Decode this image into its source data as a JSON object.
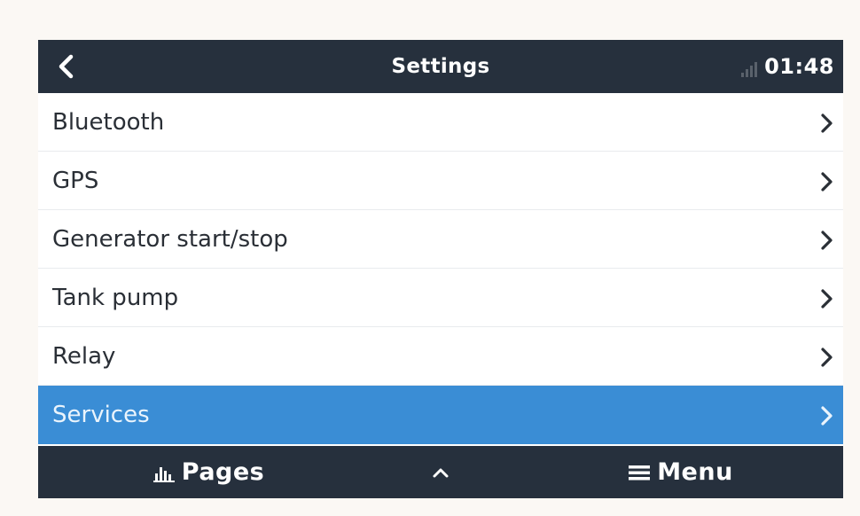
{
  "header": {
    "back_icon": "chevron-left-icon",
    "title": "Settings",
    "signal_icon": "signal-strength-icon",
    "time": "01:48"
  },
  "menu": {
    "items": [
      {
        "label": "Bluetooth",
        "selected": false,
        "icon": "chevron-right-icon"
      },
      {
        "label": "GPS",
        "selected": false,
        "icon": "chevron-right-icon"
      },
      {
        "label": "Generator start/stop",
        "selected": false,
        "icon": "chevron-right-icon"
      },
      {
        "label": "Tank pump",
        "selected": false,
        "icon": "chevron-right-icon"
      },
      {
        "label": "Relay",
        "selected": false,
        "icon": "chevron-right-icon"
      },
      {
        "label": "Services",
        "selected": true,
        "icon": "chevron-right-icon"
      }
    ]
  },
  "footer": {
    "pages_label": "Pages",
    "pages_icon": "bar-chart-icon",
    "up_icon": "chevron-up-icon",
    "menu_label": "Menu",
    "menu_icon": "hamburger-menu-icon"
  },
  "colors": {
    "bar_background": "#26303d",
    "selected_row": "#3a8dd5",
    "page_background": "#fbf8f4"
  }
}
